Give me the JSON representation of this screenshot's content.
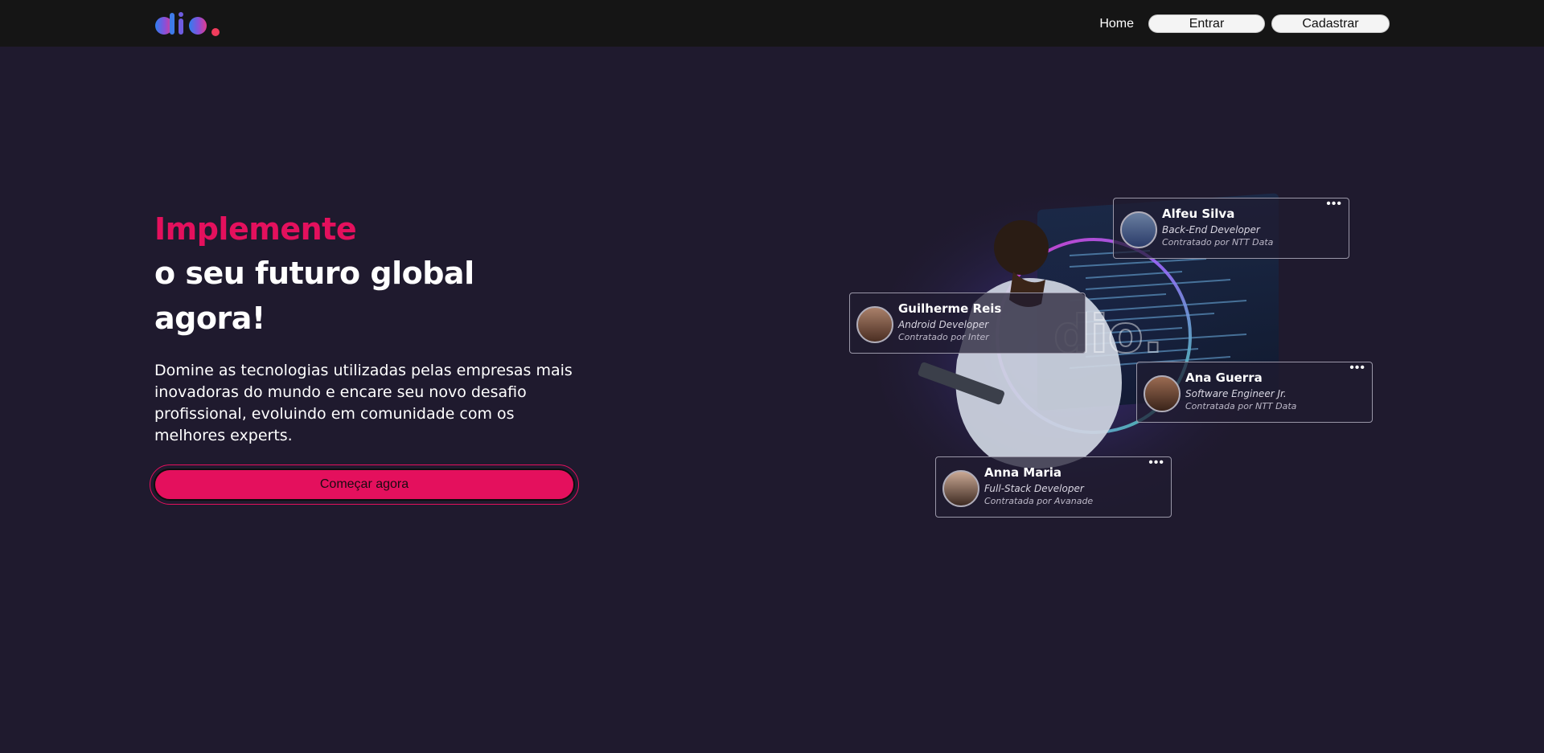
{
  "header": {
    "logo_text": "dio.",
    "nav": {
      "home": "Home",
      "entrar": "Entrar",
      "cadastrar": "Cadastrar"
    }
  },
  "hero": {
    "title_accent": "Implemente",
    "title_main": "o seu futuro global agora!",
    "description": "Domine as tecnologias utilizadas pelas empresas mais inovadoras do mundo e encare seu novo desafio profissional, evoluindo em comunidade com os melhores experts.",
    "cta": "Começar agora"
  },
  "cards": [
    {
      "name": "Alfeu Silva",
      "role": "Back-End Developer",
      "hired": "Contratado por NTT Data"
    },
    {
      "name": "Guilherme Reis",
      "role": "Android Developer",
      "hired": "Contratado por Inter"
    },
    {
      "name": "Ana Guerra",
      "role": "Software Engineer Jr.",
      "hired": "Contratada por NTT Data"
    },
    {
      "name": "Anna Maria",
      "role": "Full-Stack Developer",
      "hired": "Contratada por Avanade"
    }
  ],
  "colors": {
    "accent": "#e4105d",
    "background": "#1f1a2e",
    "header": "#151515"
  }
}
